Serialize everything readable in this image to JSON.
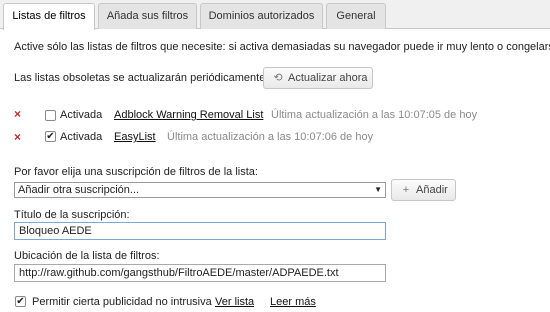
{
  "tabs": [
    {
      "label": "Listas de filtros"
    },
    {
      "label": "Añada sus filtros"
    },
    {
      "label": "Dominios autorizados"
    },
    {
      "label": "General"
    }
  ],
  "intro_text": "Active sólo las listas de filtros que necesite: si activa demasiadas su navegador puede ir muy lento o congelarse.",
  "obsolete_text": "Las listas obsoletas se actualizarán periódicamente.",
  "update_button_label": "Actualizar ahora",
  "filter_lists": [
    {
      "enabled_label": "Activada",
      "checked": false,
      "name": "Adblock Warning Removal List",
      "last_update": "Última actualización a las 10:07:05 de hoy"
    },
    {
      "enabled_label": "Activada",
      "checked": true,
      "name": "EasyList",
      "last_update": "Última actualización a las 10:07:06 de hoy"
    }
  ],
  "subscription_label": "Por favor elija una suscripción de filtros de la lista:",
  "subscription_select_value": "Añadir otra suscripción...",
  "add_button_label": "Añadir",
  "title_label": "Título de la suscripción:",
  "title_value": "Bloqueo AEDE",
  "location_label": "Ubicación de la lista de filtros:",
  "location_value": "http://raw.github.com/gangsthub/FiltroAEDE/master/ADPAEDE.txt",
  "acceptable_ads_label": "Permitir cierta publicidad no intrusiva",
  "acceptable_ads_checked": true,
  "view_list_link": "Ver lista",
  "read_more_link": "Leer más",
  "glyphs": {
    "remove": "×",
    "check": "✔",
    "refresh": "⟲",
    "plus": "+",
    "dropdown": "▼"
  }
}
